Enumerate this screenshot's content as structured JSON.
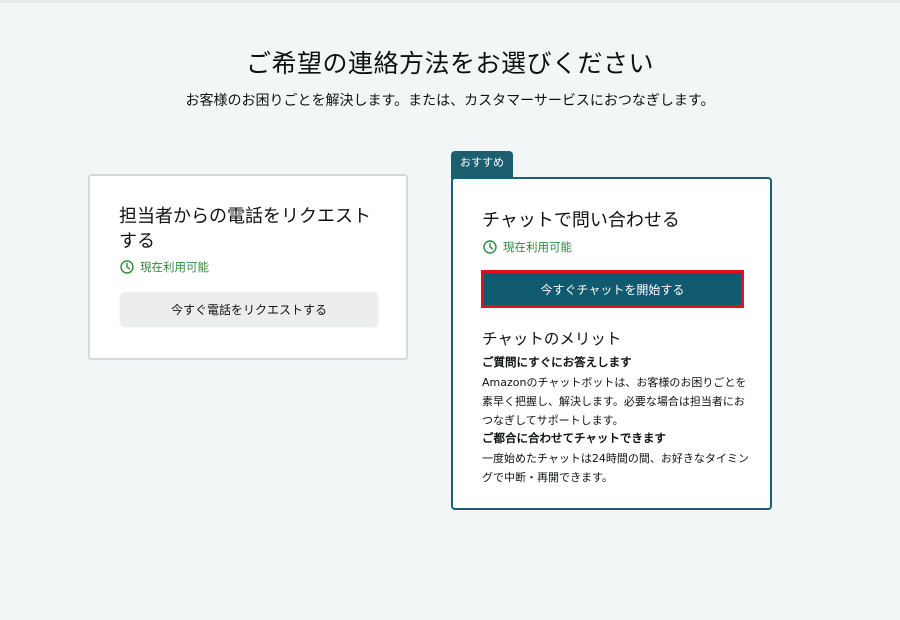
{
  "header": {
    "title": "ご希望の連絡方法をお選びください",
    "subtitle": "お客様のお困りごとを解決します。または、カスタマーサービスにおつなぎします。"
  },
  "phone_card": {
    "title_line1": "担当者からの電話をリクエスト",
    "title_line2": "する",
    "status": "現在利用可能",
    "button_label": "今すぐ電話をリクエストする"
  },
  "chat_card": {
    "badge": "おすすめ",
    "title": "チャットで問い合わせる",
    "status": "現在利用可能",
    "button_label": "今すぐチャットを開始する",
    "benefits_title": "チャットのメリット",
    "benefits": [
      {
        "heading": "ご質問にすぐにお答えします",
        "lines": [
          "Amazonのチャットボットは、お客様のお困りごとを",
          "素早く把握し、解決します。必要な場合は担当者にお",
          "つなぎしてサポートします。"
        ]
      },
      {
        "heading": "ご都合に合わせてチャットできます",
        "lines": [
          "一度始めたチャットは24時間の間、お好きなタイミン",
          "グで中断・再開できます。"
        ]
      }
    ]
  },
  "colors": {
    "background": "#f2f6f7",
    "accent": "#0f5a6e",
    "available_green": "#2e8b3d",
    "highlight_red": "#e3101a"
  },
  "icons": {
    "status": "clock-icon"
  }
}
